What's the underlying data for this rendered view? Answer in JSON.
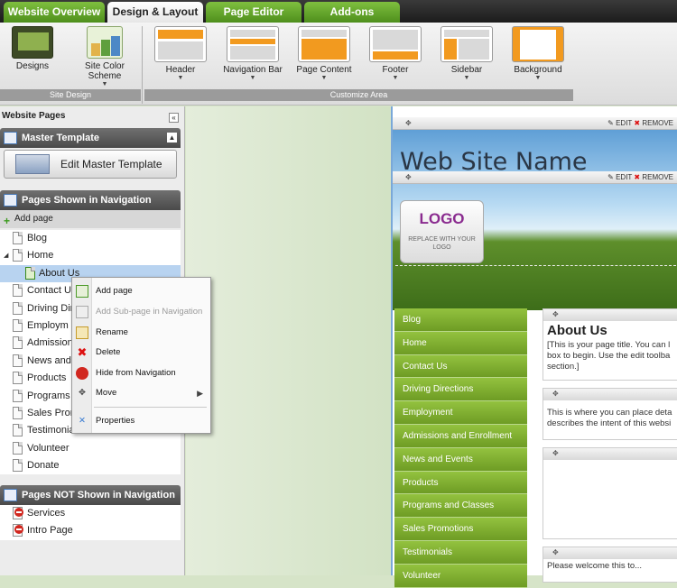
{
  "tabs": [
    {
      "label": "Website Overview",
      "active": false
    },
    {
      "label": "Design & Layout",
      "active": true
    },
    {
      "label": "Page Editor",
      "active": false
    },
    {
      "label": "Add-ons",
      "active": false
    }
  ],
  "ribbon": {
    "site_design": {
      "group_label": "Site Design",
      "designs_label": "Designs",
      "color_scheme_label": "Site Color Scheme"
    },
    "customize": {
      "group_label": "Customize Area",
      "items": [
        "Header",
        "Navigation Bar",
        "Page Content",
        "Footer",
        "Sidebar",
        "Background"
      ]
    }
  },
  "left_panel": {
    "title": "Website Pages",
    "master_template": {
      "heading": "Master Template",
      "edit_button": "Edit Master Template"
    },
    "nav_pages": {
      "heading": "Pages Shown in Navigation",
      "add_page": "Add page",
      "pages": [
        "Blog",
        "Home",
        "About Us",
        "Contact Us",
        "Driving Dire",
        "Employm",
        "Admissions",
        "News and E",
        "Products",
        "Programs a",
        "Sales Prom",
        "Testimonia",
        "Volunteer",
        "Donate"
      ]
    },
    "hidden_pages": {
      "heading": "Pages NOT Shown in Navigation",
      "pages": [
        "Services",
        "Intro Page"
      ]
    }
  },
  "context_menu": {
    "items": [
      {
        "label": "Add page",
        "disabled": false,
        "icon": "add-page-icon"
      },
      {
        "label": "Add Sub-page in Navigation",
        "disabled": true,
        "icon": "add-subpage-icon"
      },
      {
        "label": "Rename",
        "disabled": false,
        "icon": "rename-pencil-icon"
      },
      {
        "label": "Delete",
        "disabled": false,
        "icon": "delete-icon"
      },
      {
        "label": "Hide from Navigation",
        "disabled": false,
        "icon": "hide-icon"
      },
      {
        "label": "Move",
        "disabled": false,
        "icon": "move-icon",
        "submenu": true
      },
      {
        "label": "Properties",
        "disabled": false,
        "icon": "properties-tools-icon"
      }
    ]
  },
  "site_preview": {
    "edit_label": "EDIT",
    "remove_label": "REMOVE",
    "site_name": "Web Site Name",
    "logo_word": "LOGO",
    "logo_replace": "REPLACE WITH YOUR LOGO",
    "nav_items": [
      "Blog",
      "Home",
      "Contact Us",
      "Driving Directions",
      "Employment",
      "Admissions and Enrollment",
      "News and Events",
      "Products",
      "Programs and Classes",
      "Sales Promotions",
      "Testimonials",
      "Volunteer"
    ],
    "content_title": "About Us",
    "content_intro": "[This is your page title. You can l\nbox to begin. Use the edit toolba\nsection.]",
    "content_body": "This is where you can place deta\ndescribes the intent of this websi",
    "content_footer": "Please welcome this to..."
  },
  "colors": {
    "accent_green": "#7ba830",
    "tab_active_bg": "#ffffff",
    "ribbon_orange": "#f29a1f",
    "selection_blue": "#b8d3f0"
  }
}
